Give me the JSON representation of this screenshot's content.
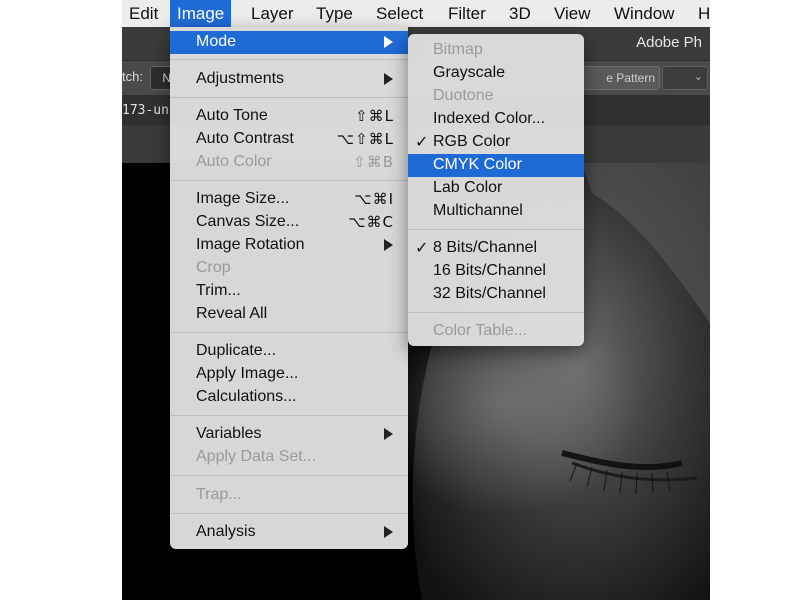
{
  "menubar": {
    "items": [
      "Edit",
      "Image",
      "Layer",
      "Type",
      "Select",
      "Filter",
      "3D",
      "View",
      "Window",
      "H"
    ],
    "active_item": "Image"
  },
  "app": {
    "title": "Adobe Ph"
  },
  "options_bar": {
    "label": "tch:",
    "field_value": "N",
    "pattern_button": "e Pattern"
  },
  "document": {
    "tab_label": "173-un"
  },
  "image_menu": {
    "items": [
      {
        "label": "Mode",
        "submenu": true,
        "highlighted": true
      },
      {
        "label": "Adjustments",
        "submenu": true
      },
      {
        "label": "Auto Tone",
        "shortcut": "⇧⌘L"
      },
      {
        "label": "Auto Contrast",
        "shortcut": "⌥⇧⌘L"
      },
      {
        "label": "Auto Color",
        "shortcut": "⇧⌘B",
        "disabled": true
      },
      {
        "label": "Image Size...",
        "shortcut": "⌥⌘I"
      },
      {
        "label": "Canvas Size...",
        "shortcut": "⌥⌘C"
      },
      {
        "label": "Image Rotation",
        "submenu": true
      },
      {
        "label": "Crop",
        "disabled": true
      },
      {
        "label": "Trim..."
      },
      {
        "label": "Reveal All"
      },
      {
        "label": "Duplicate..."
      },
      {
        "label": "Apply Image..."
      },
      {
        "label": "Calculations..."
      },
      {
        "label": "Variables",
        "submenu": true
      },
      {
        "label": "Apply Data Set...",
        "disabled": true
      },
      {
        "label": "Trap...",
        "disabled": true
      },
      {
        "label": "Analysis",
        "submenu": true
      }
    ]
  },
  "mode_submenu": {
    "items": [
      {
        "label": "Bitmap",
        "disabled": true
      },
      {
        "label": "Grayscale"
      },
      {
        "label": "Duotone",
        "disabled": true
      },
      {
        "label": "Indexed Color..."
      },
      {
        "label": "RGB Color",
        "checked": true
      },
      {
        "label": "CMYK Color",
        "highlighted": true
      },
      {
        "label": "Lab Color"
      },
      {
        "label": "Multichannel"
      },
      {
        "label": "8 Bits/Channel",
        "checked": true
      },
      {
        "label": "16 Bits/Channel"
      },
      {
        "label": "32 Bits/Channel"
      },
      {
        "label": "Color Table...",
        "disabled": true
      }
    ],
    "check_glyph": "✓"
  },
  "colors": {
    "highlight": "#1f6bd6",
    "menu_background": "#dedede",
    "disabled_text": "#9a9a9a"
  }
}
